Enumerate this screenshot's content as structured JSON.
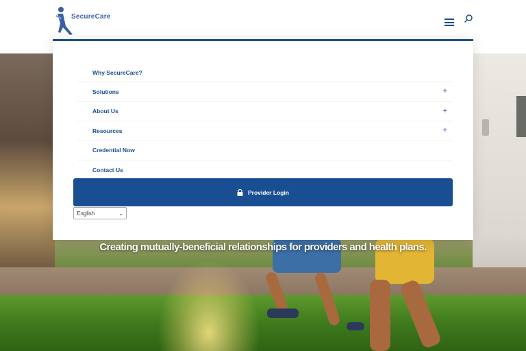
{
  "brand": {
    "name_part1": "Secure",
    "name_part2": "Care",
    "logo_icon": "person-icon",
    "accent_color": "#1b4d8f"
  },
  "header": {
    "menu_icon": "hamburger-menu-icon",
    "search_icon": "search-icon"
  },
  "menu": {
    "items": [
      {
        "label": "Why SecureCare?",
        "has_submenu": false
      },
      {
        "label": "Solutions",
        "has_submenu": true,
        "expand_symbol": "+"
      },
      {
        "label": "About Us",
        "has_submenu": true,
        "expand_symbol": "+"
      },
      {
        "label": "Resources",
        "has_submenu": true,
        "expand_symbol": "+"
      },
      {
        "label": "Credential Now",
        "has_submenu": false
      },
      {
        "label": "Contact Us",
        "has_submenu": false
      }
    ],
    "login_button": {
      "label": "Provider Login",
      "icon": "lock-icon",
      "color": "#1a4e93"
    },
    "language_select": {
      "selected": "English"
    }
  },
  "hero": {
    "tagline": "Creating mutually-beneficial relationships for providers and health plans."
  }
}
